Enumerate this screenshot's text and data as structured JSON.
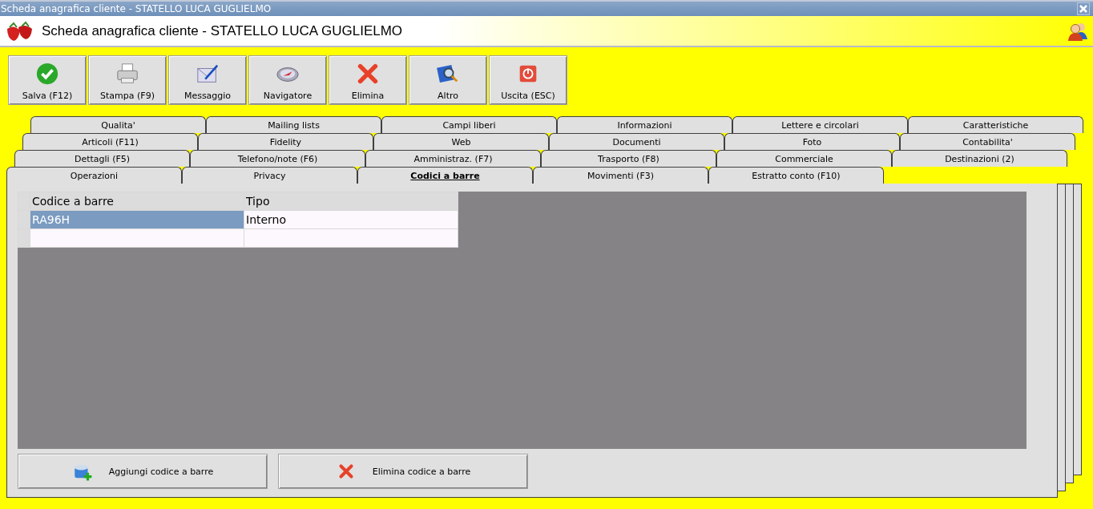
{
  "window": {
    "title": "Scheda anagrafica cliente - STATELLO LUCA GUGLIELMO"
  },
  "header": {
    "title": "Scheda anagrafica cliente - STATELLO LUCA GUGLIELMO"
  },
  "toolbar": [
    {
      "label": "Salva (F12)",
      "kind": "check"
    },
    {
      "label": "Stampa (F9)",
      "kind": "printer"
    },
    {
      "label": "Messaggio",
      "kind": "mail"
    },
    {
      "label": "Navigatore",
      "kind": "compass"
    },
    {
      "label": "Elimina",
      "kind": "cross"
    },
    {
      "label": "Altro",
      "kind": "book"
    },
    {
      "label": "Uscita (ESC)",
      "kind": "power"
    }
  ],
  "tab_rows": [
    [
      {
        "label": "Qualita'",
        "selected": false
      },
      {
        "label": "Mailing lists",
        "selected": false
      },
      {
        "label": "Campi liberi",
        "selected": false
      },
      {
        "label": "Informazioni",
        "selected": false
      },
      {
        "label": "Lettere e circolari",
        "selected": false
      },
      {
        "label": "Caratteristiche",
        "selected": false
      }
    ],
    [
      {
        "label": "Articoli (F11)",
        "selected": false
      },
      {
        "label": "Fidelity",
        "selected": false
      },
      {
        "label": "Web",
        "selected": false
      },
      {
        "label": "Documenti",
        "selected": false
      },
      {
        "label": "Foto",
        "selected": false
      },
      {
        "label": "Contabilita'",
        "selected": false
      }
    ],
    [
      {
        "label": "Dettagli (F5)",
        "selected": false
      },
      {
        "label": "Telefono/note (F6)",
        "selected": false
      },
      {
        "label": "Amministraz. (F7)",
        "selected": false
      },
      {
        "label": "Trasporto (F8)",
        "selected": false
      },
      {
        "label": "Commerciale",
        "selected": false
      },
      {
        "label": "Destinazioni (2)",
        "selected": false
      }
    ],
    [
      {
        "label": "Operazioni",
        "selected": false
      },
      {
        "label": "Privacy",
        "selected": false
      },
      {
        "label": "Codici a barre",
        "selected": true
      },
      {
        "label": "Movimenti (F3)",
        "selected": false
      },
      {
        "label": "Estratto conto (F10)",
        "selected": false
      }
    ]
  ],
  "table": {
    "columns": [
      "Codice a barre",
      "Tipo"
    ],
    "rows": [
      {
        "cells": [
          "RA96H",
          "Interno"
        ],
        "selected": true
      }
    ]
  },
  "actions": [
    {
      "label": "Aggiungi codice a barre",
      "kind": "add"
    },
    {
      "label": "Elimina codice a barre",
      "kind": "delete"
    }
  ]
}
